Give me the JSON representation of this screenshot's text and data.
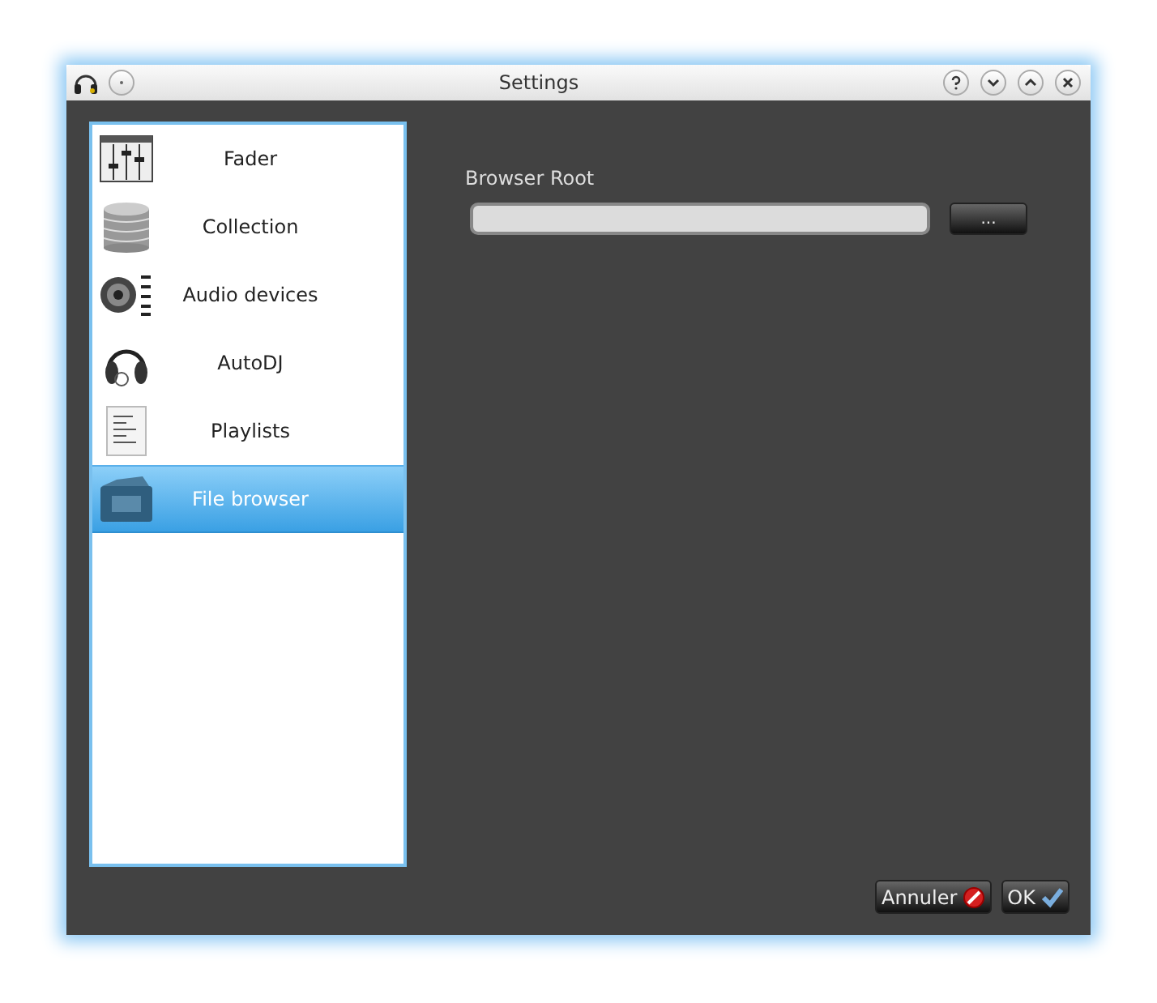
{
  "window": {
    "title": "Settings"
  },
  "sidebar": {
    "items": [
      {
        "label": "Fader",
        "kind": "fader",
        "selected": false
      },
      {
        "label": "Collection",
        "kind": "collection",
        "selected": false
      },
      {
        "label": "Audio devices",
        "kind": "audio",
        "selected": false
      },
      {
        "label": "AutoDJ",
        "kind": "autodj",
        "selected": false
      },
      {
        "label": "Playlists",
        "kind": "playlists",
        "selected": false
      },
      {
        "label": "File browser",
        "kind": "browser",
        "selected": true
      }
    ]
  },
  "browser_root": {
    "label": "Browser Root",
    "browse_button": "..."
  },
  "buttons": [
    {
      "label": "Annuler",
      "kind": "cancel"
    },
    {
      "label": "OK",
      "kind": "ok"
    }
  ]
}
